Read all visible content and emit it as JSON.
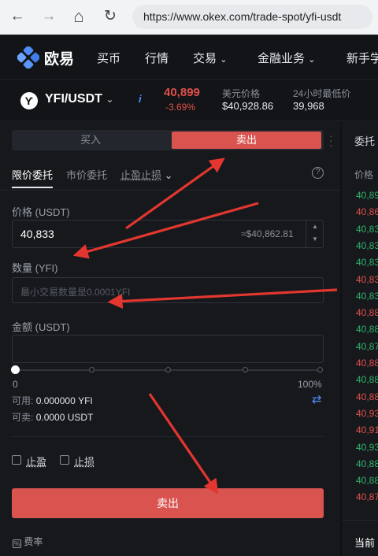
{
  "browser": {
    "url": "https://www.okex.com/trade-spot/yfi-usdt",
    "back_icon": "←",
    "forward_icon": "→",
    "home_icon": "⌂",
    "reload_icon": "↻"
  },
  "header": {
    "logo": "欧易",
    "nav": [
      "买币",
      "行情",
      "交易",
      "金融业务",
      "新手学"
    ]
  },
  "pair": {
    "name": "YFI/USDT",
    "price": "40,899",
    "change": "-3.69%",
    "usd_label": "美元价格",
    "usd_value": "$40,928.86",
    "low_label": "24小时最低价",
    "low_value": "39,968"
  },
  "trade": {
    "buy_tab": "买入",
    "sell_tab": "卖出",
    "order_types": [
      "限价委托",
      "市价委托",
      "止盈止损"
    ],
    "price_label": "价格 (USDT)",
    "price_value": "40,833",
    "price_usd": "≈$40,862.81",
    "amount_label": "数量 (YFI)",
    "amount_placeholder": "最小交易数量是0.0001YFI",
    "total_label": "金额 (USDT)",
    "slider_min": "0",
    "slider_max": "100%",
    "avail_label": "可用:",
    "avail_value": "0.000000 YFI",
    "sellable_label": "可卖:",
    "sellable_value": "0.0000 USDT",
    "take_profit": "止盈",
    "stop_loss": "止损",
    "submit": "卖出",
    "fee": "费率"
  },
  "orderbook": {
    "title": "委托",
    "col": "价格",
    "rows": [
      {
        "p": "40,89",
        "c": "green"
      },
      {
        "p": "40,86",
        "c": "red"
      },
      {
        "p": "40,83",
        "c": "green"
      },
      {
        "p": "40,83",
        "c": "green"
      },
      {
        "p": "40,83",
        "c": "green"
      },
      {
        "p": "40,83",
        "c": "red"
      },
      {
        "p": "40,83",
        "c": "green"
      },
      {
        "p": "40,88",
        "c": "red"
      },
      {
        "p": "40,88",
        "c": "green"
      },
      {
        "p": "40,87",
        "c": "green"
      },
      {
        "p": "40,88",
        "c": "red"
      },
      {
        "p": "40,88",
        "c": "green"
      },
      {
        "p": "40,88",
        "c": "red"
      },
      {
        "p": "40,93",
        "c": "red"
      },
      {
        "p": "40,91",
        "c": "red"
      },
      {
        "p": "40,93",
        "c": "green"
      },
      {
        "p": "40,88",
        "c": "green"
      },
      {
        "p": "40,88",
        "c": "green"
      },
      {
        "p": "40,87",
        "c": "red"
      }
    ],
    "footer": "当前"
  },
  "colors": {
    "accent_red": "#d9534f",
    "up_green": "#2fb26c",
    "down_red": "#e0504a",
    "annotation_arrow": "#e2362f"
  }
}
